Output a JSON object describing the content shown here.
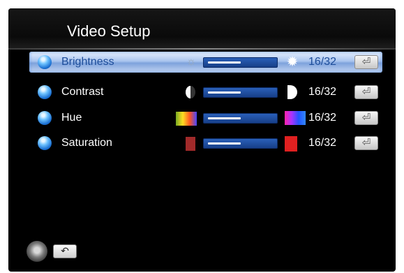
{
  "screen": {
    "title": "Video Setup",
    "items": [
      {
        "label": "Brightness",
        "value": "16/32",
        "level": 0.5,
        "icon_left": "sun-small-icon",
        "icon_right": "sun-icon",
        "active": true
      },
      {
        "label": "Contrast",
        "value": "16/32",
        "level": 0.5,
        "icon_left": "contrast-half-icon",
        "icon_right": "crescent-icon",
        "active": false
      },
      {
        "label": "Hue",
        "value": "16/32",
        "level": 0.5,
        "icon_left": "hue-spectrum-icon",
        "icon_right": "hue-spectrum-icon",
        "active": false
      },
      {
        "label": "Saturation",
        "value": "16/32",
        "level": 0.5,
        "icon_left": "saturation-low-icon",
        "icon_right": "saturation-high-icon",
        "active": false
      }
    ],
    "enter_symbol": "⏎",
    "footer": {
      "nav_icon": "dpad-icon",
      "back_symbol": "↶"
    },
    "colors": {
      "highlight": "#a9c4ee",
      "slider_track": "#2a5fb8",
      "background": "#000000"
    }
  }
}
